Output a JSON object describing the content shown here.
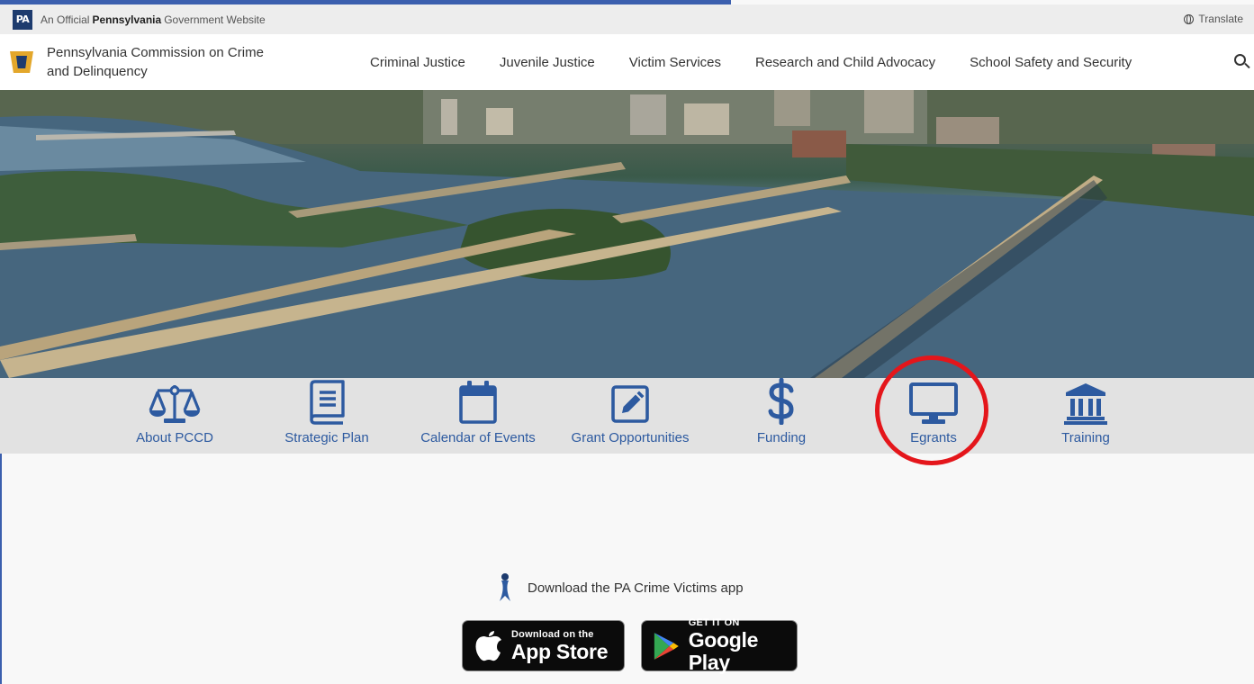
{
  "gov_bar": {
    "badge": "PA",
    "prefix": "An Official",
    "state": "Pennsylvania",
    "suffix": "Government Website",
    "translate_label": "Translate"
  },
  "header": {
    "agency_line1": "Pennsylvania Commission on Crime",
    "agency_line2": "and Delinquency"
  },
  "nav": {
    "items": [
      {
        "label": "Criminal Justice"
      },
      {
        "label": "Juvenile Justice"
      },
      {
        "label": "Victim Services"
      },
      {
        "label": "Research and Child Advocacy"
      },
      {
        "label": "School Safety and Security"
      }
    ]
  },
  "quick_links": {
    "items": [
      {
        "label": "About PCCD",
        "icon": "scales-icon"
      },
      {
        "label": "Strategic Plan",
        "icon": "book-icon"
      },
      {
        "label": "Calendar of Events",
        "icon": "calendar-icon"
      },
      {
        "label": "Grant Opportunities",
        "icon": "edit-square-icon"
      },
      {
        "label": "Funding",
        "icon": "dollar-icon"
      },
      {
        "label": "Egrants",
        "icon": "monitor-icon"
      },
      {
        "label": "Training",
        "icon": "government-building-icon"
      }
    ],
    "highlighted": "Egrants",
    "accent_color": "#2d5aa0",
    "highlight_color": "#e4161b"
  },
  "app_promo": {
    "label": "Download the PA Crime Victims app",
    "apple_small": "Download on the",
    "apple_big": "App Store",
    "google_small": "GET IT ON",
    "google_big": "Google Play"
  }
}
